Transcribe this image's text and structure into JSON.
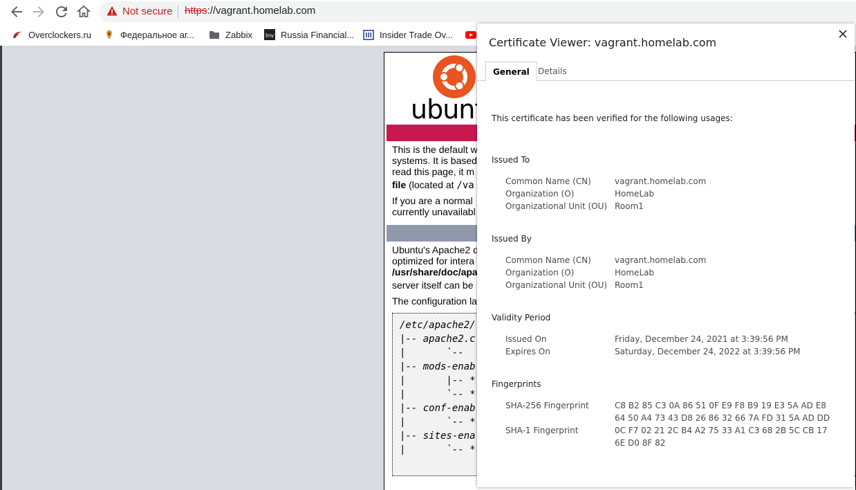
{
  "toolbar": {
    "security_label": "Not secure",
    "url_scheme": "https",
    "url_rest": "://vagrant.homelab.com"
  },
  "bookmarks": [
    {
      "label": "Overclockers.ru"
    },
    {
      "label": "Федеральное аг..."
    },
    {
      "label": "Zabbix"
    },
    {
      "label": "Russia Financial..."
    },
    {
      "label": "Insider Trade Ov..."
    }
  ],
  "apache_page": {
    "logo_text": "ubuntu",
    "p1_line1": "This is the default w",
    "p1_line2": "systems. It is based",
    "p1_line3": "read this page, it m",
    "p1_line4_bold": "file",
    "p1_line4_rest": " (located at ",
    "p1_line4_mono": "/va",
    "p2_line1": "If you are a normal",
    "p2_line2": "currently unavailabl",
    "p3_line1": "Ubuntu's Apache2 d",
    "p3_line2": "optimized for intera",
    "p3_line3_bold": "/usr/share/doc/apa",
    "p3_line4": "server itself can be",
    "p4_line1": "The configuration la",
    "tree": [
      "/etc/apache2/",
      "|-- apache2.c",
      "|       `--  ",
      "|-- mods-enab",
      "|       |-- *",
      "|       `-- *",
      "|-- conf-enab",
      "|       `-- *",
      "|-- sites-ena",
      "|       `-- *"
    ]
  },
  "cert_viewer": {
    "title": "Certificate Viewer: vagrant.homelab.com",
    "tabs": [
      {
        "label": "General",
        "active": true
      },
      {
        "label": "Details",
        "active": false
      }
    ],
    "verified_text": "This certificate has been verified for the following usages:",
    "issued_to": {
      "heading": "Issued To",
      "rows": [
        {
          "label": "Common Name (CN)",
          "value": "vagrant.homelab.com"
        },
        {
          "label": "Organization (O)",
          "value": "HomeLab"
        },
        {
          "label": "Organizational Unit (OU)",
          "value": "Room1"
        }
      ]
    },
    "issued_by": {
      "heading": "Issued By",
      "rows": [
        {
          "label": "Common Name (CN)",
          "value": "vagrant.homelab.com"
        },
        {
          "label": "Organization (O)",
          "value": "HomeLab"
        },
        {
          "label": "Organizational Unit (OU)",
          "value": "Room1"
        }
      ]
    },
    "validity": {
      "heading": "Validity Period",
      "rows": [
        {
          "label": "Issued On",
          "value": "Friday, December 24, 2021 at 3:39:56 PM"
        },
        {
          "label": "Expires On",
          "value": "Saturday, December 24, 2022 at 3:39:56 PM"
        }
      ]
    },
    "fingerprints": {
      "heading": "Fingerprints",
      "sha256_label": "SHA-256 Fingerprint",
      "sha256_line1": "C8 B2 85 C3 0A 86 51 0F E9 F8 B9 19 E3 5A AD E8",
      "sha256_line2": "64 50 A4 73 43 D8 26 86 32 66 7A FD 31 5A AD DD",
      "sha1_label": "SHA-1 Fingerprint",
      "sha1_line1": "0C F7 02 21 2C B4 A2 75 33 A1 C3 68 2B 5C CB 17",
      "sha1_line2": "6E D0 8F 82"
    }
  },
  "colors": {
    "warning_red": "#c5221f",
    "ubuntu_orange": "#e95420",
    "ubuntu_banner": "#c7194f",
    "banner_grey": "#8f99ab"
  }
}
